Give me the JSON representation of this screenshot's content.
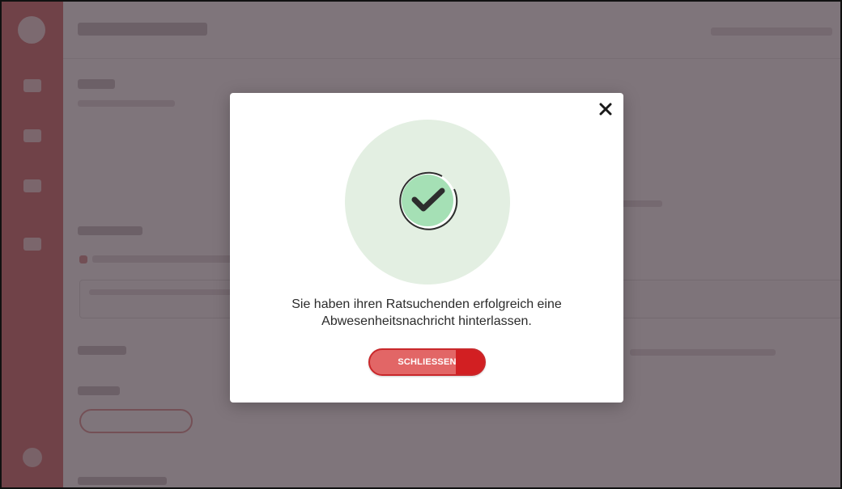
{
  "modal": {
    "message_line1": "Sie haben ihren Ratsuchenden erfolgreich eine",
    "message_line2": "Abwesenheitsnachricht hinterlassen.",
    "close_button_label": "SCHLIESSEN",
    "close_icon": "close-icon",
    "illustration_icon": "checkmark-success-icon"
  },
  "colors": {
    "brand_red": "#d21f22",
    "sidebar_red": "#c9494a",
    "success_green_light": "#e3efe2",
    "success_green": "#a5e0b5",
    "overlay": "#4e4048"
  }
}
